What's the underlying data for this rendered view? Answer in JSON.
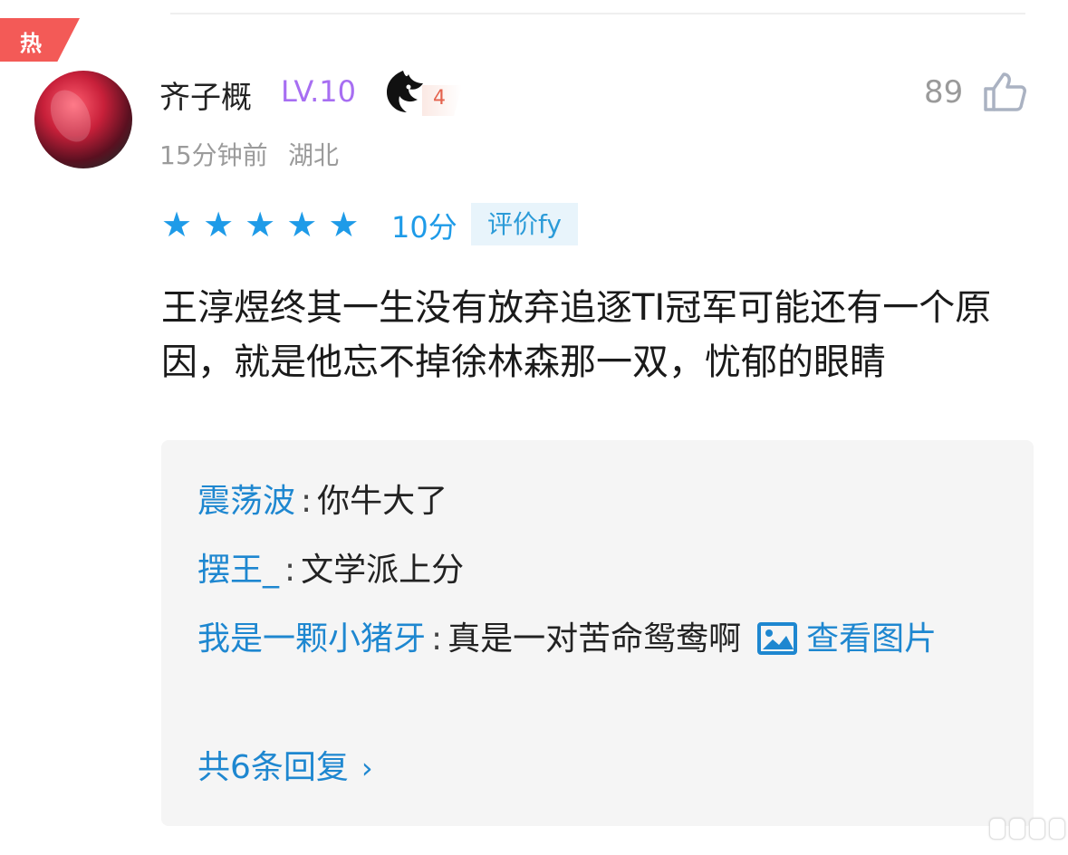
{
  "badge": {
    "label": "热"
  },
  "comment": {
    "author": "齐子概",
    "level": "LV.10",
    "guild_icon": "dragon-emblem-icon",
    "guild_number": "4",
    "like_count": "89",
    "time": "15分钟前",
    "location": "湖北",
    "rating": {
      "stars": 5,
      "max": 5,
      "score_label": "10分"
    },
    "review_tag": "评价fy",
    "text": "王淳煜终其一生没有放弃追逐TI冠军可能还有一个原因，就是他忘不掉徐林森那一双，忧郁的眼睛"
  },
  "replies": [
    {
      "name": "震荡波",
      "colon": ":",
      "text": "你牛大了"
    },
    {
      "name": "摆王_",
      "colon": ":",
      "text": "文学派上分"
    },
    {
      "name": "我是一颗小猪牙",
      "colon": ":",
      "text": "真是一对苦命鸳鸯啊",
      "image_link": "查看图片"
    }
  ],
  "more_replies": "共6条回复",
  "colors": {
    "accent": "#1e87d0",
    "hot": "#f35a57",
    "level": "#a76ef2"
  }
}
